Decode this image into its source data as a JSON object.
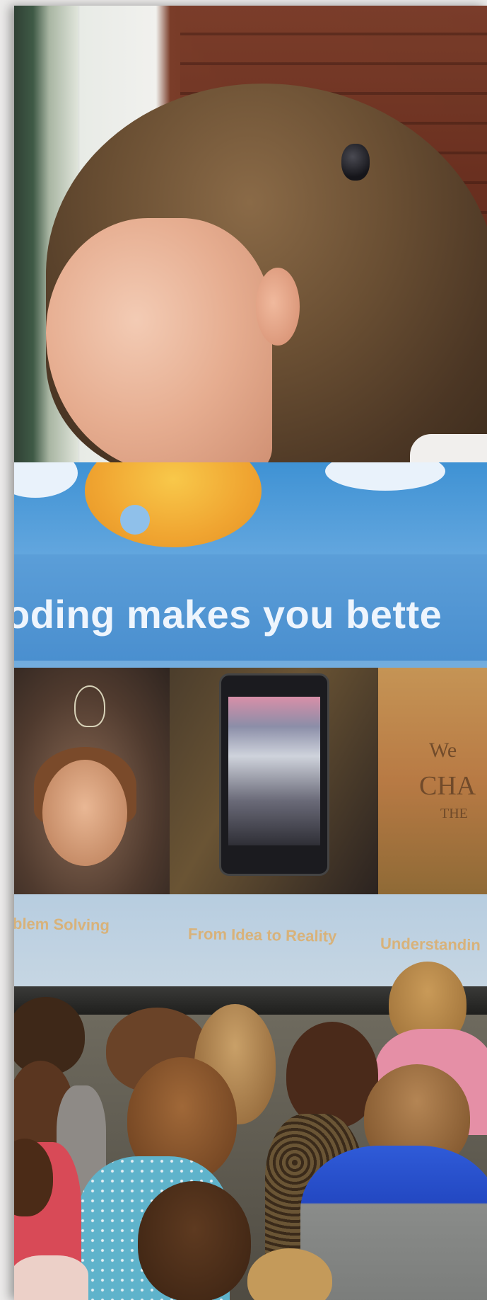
{
  "slide": {
    "title": "oding makes you bette",
    "captions": [
      "blem Solving",
      "From Idea to Reality",
      "Understandin"
    ],
    "foot_words": [
      "We",
      "CHA",
      "THE"
    ]
  }
}
